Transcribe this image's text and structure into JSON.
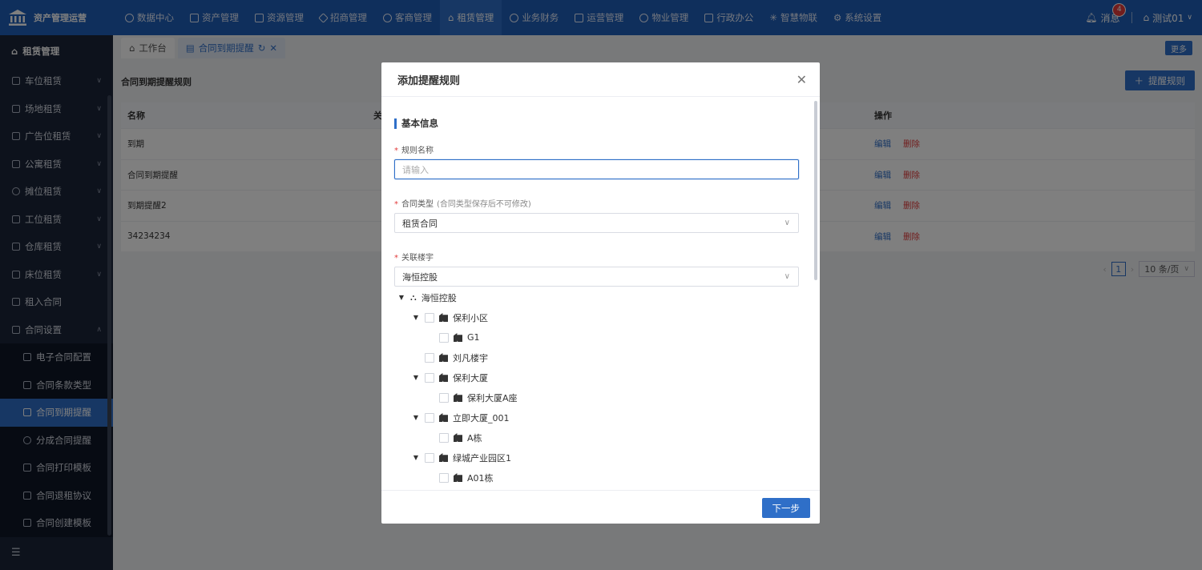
{
  "brand": {
    "name": "资产管理运营"
  },
  "nav": [
    {
      "label": "数据中心",
      "icon": "dashboard-icon"
    },
    {
      "label": "资产管理",
      "icon": "cube-icon"
    },
    {
      "label": "资源管理",
      "icon": "building-icon"
    },
    {
      "label": "招商管理",
      "icon": "diamond-icon"
    },
    {
      "label": "客商管理",
      "icon": "users-icon"
    },
    {
      "label": "租赁管理",
      "icon": "home-icon"
    },
    {
      "label": "业务财务",
      "icon": "coin-icon"
    },
    {
      "label": "运营管理",
      "icon": "chart-icon"
    },
    {
      "label": "物业管理",
      "icon": "smile-icon"
    },
    {
      "label": "行政办公",
      "icon": "monitor-icon"
    },
    {
      "label": "智慧物联",
      "icon": "iot-icon"
    },
    {
      "label": "系统设置",
      "icon": "gear-icon"
    }
  ],
  "topright": {
    "messages_label": "消息",
    "messages_count": "4",
    "user_label": "测试01"
  },
  "sidebar": {
    "title": "租赁管理",
    "items": [
      {
        "label": "车位租赁"
      },
      {
        "label": "场地租赁"
      },
      {
        "label": "广告位租赁"
      },
      {
        "label": "公寓租赁"
      },
      {
        "label": "摊位租赁"
      },
      {
        "label": "工位租赁"
      },
      {
        "label": "仓库租赁"
      },
      {
        "label": "床位租赁"
      },
      {
        "label": "租入合同"
      },
      {
        "label": "合同设置"
      }
    ],
    "subitems": [
      {
        "label": "电子合同配置"
      },
      {
        "label": "合同条款类型"
      },
      {
        "label": "合同到期提醒"
      },
      {
        "label": "分成合同提醒"
      },
      {
        "label": "合同打印模板"
      },
      {
        "label": "合同退租协议"
      },
      {
        "label": "合同创建模板"
      }
    ]
  },
  "tabs": [
    {
      "label": "工作台"
    },
    {
      "label": "合同到期提醒"
    }
  ],
  "more_label": "更多",
  "page": {
    "title": "合同到期提醒规则",
    "add_button": "提醒规则",
    "columns": {
      "name": "名称",
      "col2": "关",
      "action": "操作"
    },
    "rows": [
      {
        "name": "到期",
        "edit": "编辑",
        "delete": "删除"
      },
      {
        "name": "合同到期提醒",
        "edit": "编辑",
        "delete": "删除"
      },
      {
        "name": "到期提醒2",
        "edit": "编辑",
        "delete": "删除"
      },
      {
        "name": "34234234",
        "edit": "编辑",
        "delete": "删除"
      }
    ],
    "pager": {
      "current": "1",
      "size": "10 条/页"
    }
  },
  "dialog": {
    "title": "添加提醒规则",
    "section": "基本信息",
    "rule_name": {
      "label": "规则名称",
      "placeholder": "请输入"
    },
    "contract_type": {
      "label": "合同类型",
      "hint": "(合同类型保存后不可修改)",
      "value": "租赁合同"
    },
    "building": {
      "label": "关联楼宇",
      "value": "海恒控股"
    },
    "tree": [
      {
        "label": "海恒控股",
        "level": 0
      },
      {
        "label": "保利小区",
        "level": 1
      },
      {
        "label": "G1",
        "level": 2
      },
      {
        "label": "刘凡楼宇",
        "level": 1
      },
      {
        "label": "保利大厦",
        "level": 1
      },
      {
        "label": "保利大厦A座",
        "level": 2
      },
      {
        "label": "立即大厦_001",
        "level": 1
      },
      {
        "label": "A栋",
        "level": 2
      },
      {
        "label": "绿城产业园区1",
        "level": 1
      },
      {
        "label": "A01栋",
        "level": 2
      }
    ],
    "next_button": "下一步"
  }
}
